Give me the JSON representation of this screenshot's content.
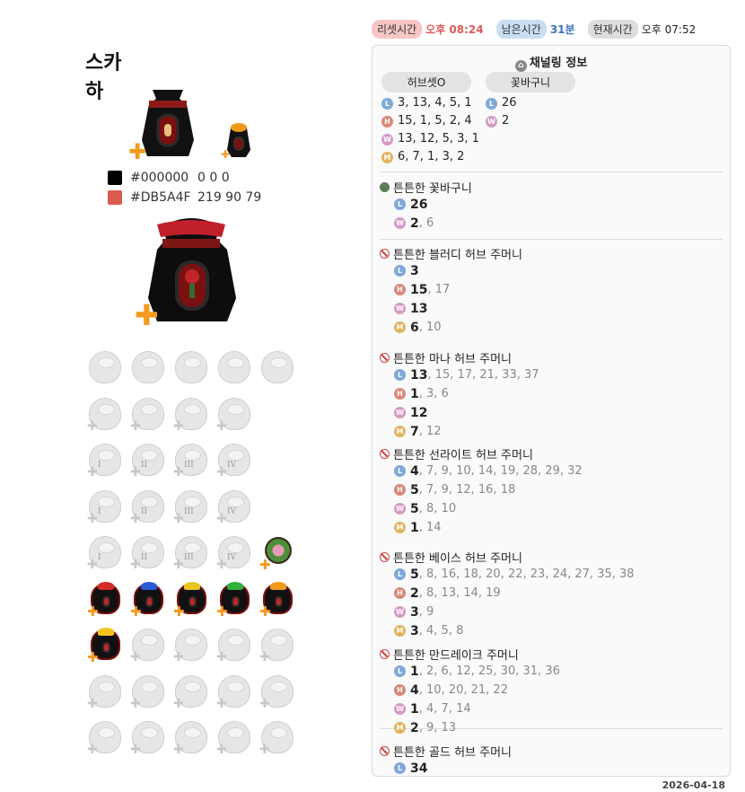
{
  "title": "스카하",
  "colors": [
    {
      "hex": "#000000",
      "rgb": "0 0 0"
    },
    {
      "hex": "#DB5A4F",
      "rgb": "219 90 79"
    }
  ],
  "timebar": {
    "reset_label": "리셋시간",
    "reset_value": "오후 08:24",
    "remain_label": "남은시간",
    "remain_value": "31분",
    "now_label": "현재시간",
    "now_value": "오후 07:52"
  },
  "panel": {
    "header": "채널링 정보",
    "tab_1": "허브셋O",
    "tab_2": "꽃바구니",
    "codes_left": [
      {
        "type": "L",
        "text": "3, 13, 4, 5, 1"
      },
      {
        "type": "H",
        "text": "15, 1, 5, 2, 4"
      },
      {
        "type": "W",
        "text": "13, 12, 5, 3, 1"
      },
      {
        "type": "M",
        "text": "6, 7, 1, 3, 2"
      }
    ],
    "codes_right": [
      {
        "type": "L",
        "text": "26"
      },
      {
        "type": "W",
        "text": "2"
      }
    ],
    "sections": [
      {
        "status": "ok",
        "name": "튼튼한 꽃바구니",
        "rows": [
          {
            "type": "L",
            "main": "26",
            "rest": ""
          },
          {
            "type": "W",
            "main": "2",
            "rest": ", 6"
          }
        ]
      },
      {
        "status": "no",
        "name": "튼튼한 블러디 허브 주머니",
        "rows": [
          {
            "type": "L",
            "main": "3",
            "rest": ""
          },
          {
            "type": "H",
            "main": "15",
            "rest": ", 17"
          },
          {
            "type": "W",
            "main": "13",
            "rest": ""
          },
          {
            "type": "M",
            "main": "6",
            "rest": ", 10"
          }
        ]
      },
      {
        "status": "no",
        "name": "튼튼한 마나 허브 주머니",
        "rows": [
          {
            "type": "L",
            "main": "13",
            "rest": ", 15, 17, 21, 33, 37"
          },
          {
            "type": "H",
            "main": "1",
            "rest": ", 3, 6"
          },
          {
            "type": "W",
            "main": "12",
            "rest": ""
          },
          {
            "type": "M",
            "main": "7",
            "rest": ", 12"
          }
        ]
      },
      {
        "status": "no",
        "name": "튼튼한 선라이트 허브 주머니",
        "rows": [
          {
            "type": "L",
            "main": "4",
            "rest": ", 7, 9, 10, 14, 19, 28, 29, 32"
          },
          {
            "type": "H",
            "main": "5",
            "rest": ", 7, 9, 12, 16, 18"
          },
          {
            "type": "W",
            "main": "5",
            "rest": ", 8, 10"
          },
          {
            "type": "M",
            "main": "1",
            "rest": ", 14"
          }
        ]
      },
      {
        "status": "no",
        "name": "튼튼한 베이스 허브 주머니",
        "rows": [
          {
            "type": "L",
            "main": "5",
            "rest": ", 8, 16, 18, 20, 22, 23, 24, 27, 35, 38"
          },
          {
            "type": "H",
            "main": "2",
            "rest": ", 8, 13, 14, 19"
          },
          {
            "type": "W",
            "main": "3",
            "rest": ", 9"
          },
          {
            "type": "M",
            "main": "3",
            "rest": ", 4, 5, 8"
          }
        ]
      },
      {
        "status": "no",
        "name": "튼튼한 만드레이크 주머니",
        "rows": [
          {
            "type": "L",
            "main": "1",
            "rest": ", 2, 6, 12, 25, 30, 31, 36"
          },
          {
            "type": "H",
            "main": "4",
            "rest": ", 10, 20, 21, 22"
          },
          {
            "type": "W",
            "main": "1",
            "rest": ", 4, 7, 14"
          },
          {
            "type": "M",
            "main": "2",
            "rest": ", 9, 13"
          }
        ]
      },
      {
        "status": "no",
        "name": "튼튼한 골드 허브 주머니",
        "rows": [
          {
            "type": "L",
            "main": "34",
            "rest": ""
          }
        ]
      }
    ]
  },
  "grid_roman": [
    "I",
    "II",
    "III",
    "IV"
  ],
  "opus_crowns": [
    "#d42a2a",
    "#2a5ad8",
    "#e8c51f",
    "#2fb23a",
    "#f09a1a",
    "#f5c21c"
  ],
  "date": "2026-04-18"
}
